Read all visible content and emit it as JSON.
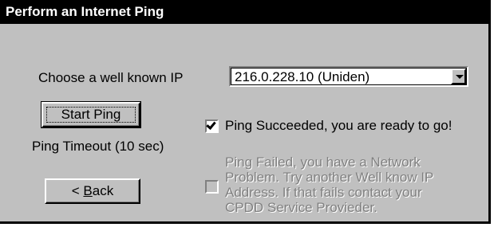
{
  "window": {
    "title": "Perform an Internet Ping"
  },
  "ip_chooser": {
    "label": "Choose a well known IP",
    "selected_value": "216.0.228.10 (Uniden)"
  },
  "start_ping_button": {
    "label": "Start Ping"
  },
  "timeout_label": "Ping Timeout (10 sec)",
  "back_button": {
    "accelerator": "B",
    "label_rest": "ack",
    "prefix": "< "
  },
  "success_check": {
    "checked": true,
    "label": "Ping Succeeded, you are ready to go!"
  },
  "failure_check": {
    "checked": false,
    "enabled": false,
    "label": "Ping Failed, you have a Network Problem.  Try another Well know IP Address.  If that fails contact your CPDD Service Provieder."
  },
  "colors": {
    "face": "#c0c0c0",
    "titlebar": "#000000",
    "disabled_text": "#808080"
  },
  "icons": {
    "combo_arrow": "chevron-down-icon",
    "check": "checkmark-icon"
  }
}
